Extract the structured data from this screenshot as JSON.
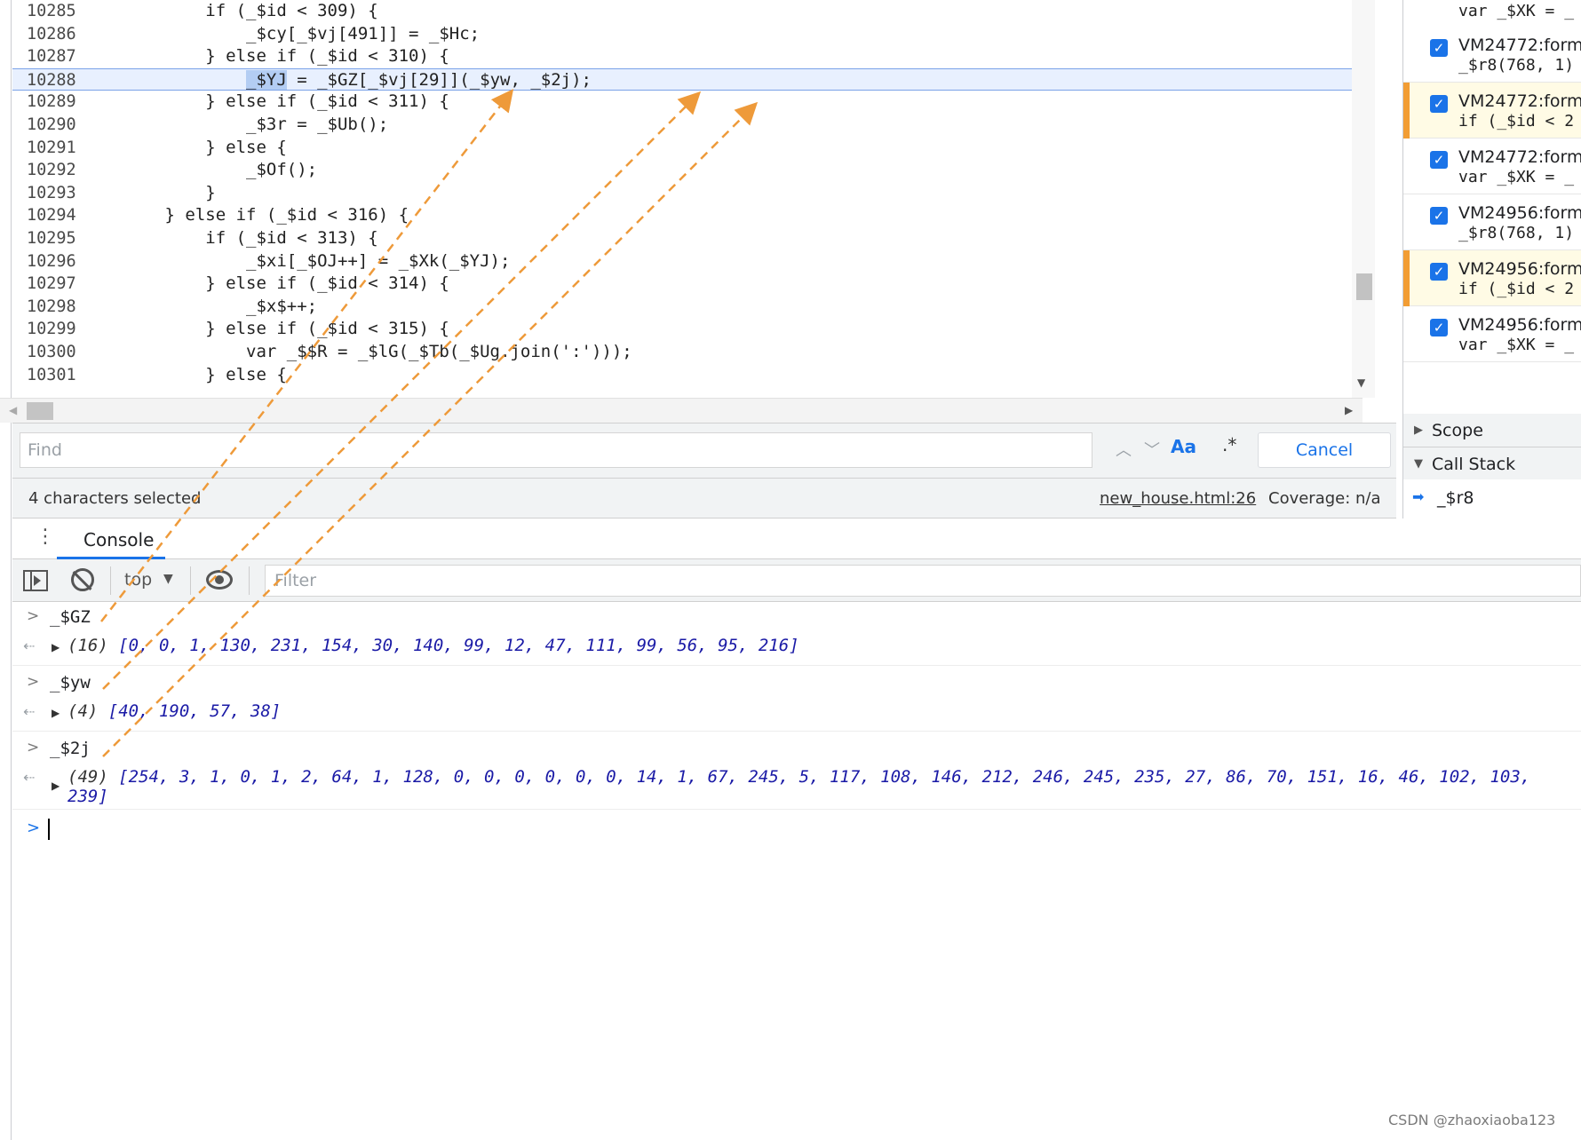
{
  "editor": {
    "lines": [
      {
        "num": "10285",
        "code": "            if (_$id < 309) {"
      },
      {
        "num": "10286",
        "code": "                _$cy[_$vj[491]] = _$Hc;"
      },
      {
        "num": "10287",
        "code": "            } else if (_$id < 310) {"
      },
      {
        "num": "10288",
        "code_pre": "                ",
        "code_sel": "_$YJ",
        "code_post": " = _$GZ[_$vj[29]](_$yw, _$2j);",
        "highlighted": true
      },
      {
        "num": "10289",
        "code": "            } else if (_$id < 311) {"
      },
      {
        "num": "10290",
        "code": "                _$3r = _$Ub();"
      },
      {
        "num": "10291",
        "code": "            } else {"
      },
      {
        "num": "10292",
        "code": "                _$Of();"
      },
      {
        "num": "10293",
        "code": "            }"
      },
      {
        "num": "10294",
        "code": "        } else if (_$id < 316) {"
      },
      {
        "num": "10295",
        "code": "            if (_$id < 313) {"
      },
      {
        "num": "10296",
        "code": "                _$xi[_$OJ++] = _$Xk(_$YJ);"
      },
      {
        "num": "10297",
        "code": "            } else if (_$id < 314) {"
      },
      {
        "num": "10298",
        "code": "                _$x$++;"
      },
      {
        "num": "10299",
        "code": "            } else if (_$id < 315) {"
      },
      {
        "num": "10300",
        "code": "                var _$$R = _$lG(_$Tb(_$Ug.join(':')));"
      },
      {
        "num": "10301",
        "code": "            } else {"
      }
    ]
  },
  "find_bar": {
    "placeholder": "Find",
    "case_label": "Aa",
    "regex_label": ".*",
    "cancel_label": "Cancel"
  },
  "status_bar": {
    "selection": "4 characters selected",
    "source_link": "new_house.html:26",
    "coverage": "Coverage: n/a"
  },
  "debugger": {
    "top_code": "var _$XK = _",
    "breakpoints": [
      {
        "file": "VM24772:form",
        "code": "_$r8(768, 1)",
        "active": false
      },
      {
        "file": "VM24772:form",
        "code": "if (_$id < 2",
        "active": true
      },
      {
        "file": "VM24772:form",
        "code": "var _$XK = _",
        "active": false
      },
      {
        "file": "VM24956:form",
        "code": "_$r8(768, 1)",
        "active": false
      },
      {
        "file": "VM24956:form",
        "code": "if (_$id < 2",
        "active": true
      },
      {
        "file": "VM24956:form",
        "code": "var _$XK = _",
        "active": false
      }
    ],
    "scope_label": "Scope",
    "call_stack_label": "Call Stack",
    "current_frame": "_$r8"
  },
  "console": {
    "tab_label": "Console",
    "context": "top",
    "filter_placeholder": "Filter",
    "entries": [
      {
        "input": "_$GZ",
        "count": "(16)",
        "result": "[0, 0, 1, 130, 231, 154, 30, 140, 99, 12, 47, 111, 99, 56, 95, 216]"
      },
      {
        "input": "_$yw",
        "count": "(4)",
        "result": "[40, 190, 57, 38]"
      },
      {
        "input": "_$2j",
        "count": "(49)",
        "result": "[254, 3, 1, 0, 1, 2, 64, 1, 128, 0, 0, 0, 0, 0, 0, 14, 1, 67, 245, 5, 117, 108, 146, 212, 246, 245, 235, 27, 86, 70, 151, 16, 46, 102, 103,",
        "result_line2": "239]"
      }
    ]
  },
  "watermark": "CSDN @zhaoxiaoba123",
  "colors": {
    "accent": "#1a73e8",
    "arrow": "#ee9a3a",
    "breakpoint_marker": "#f29d34"
  }
}
